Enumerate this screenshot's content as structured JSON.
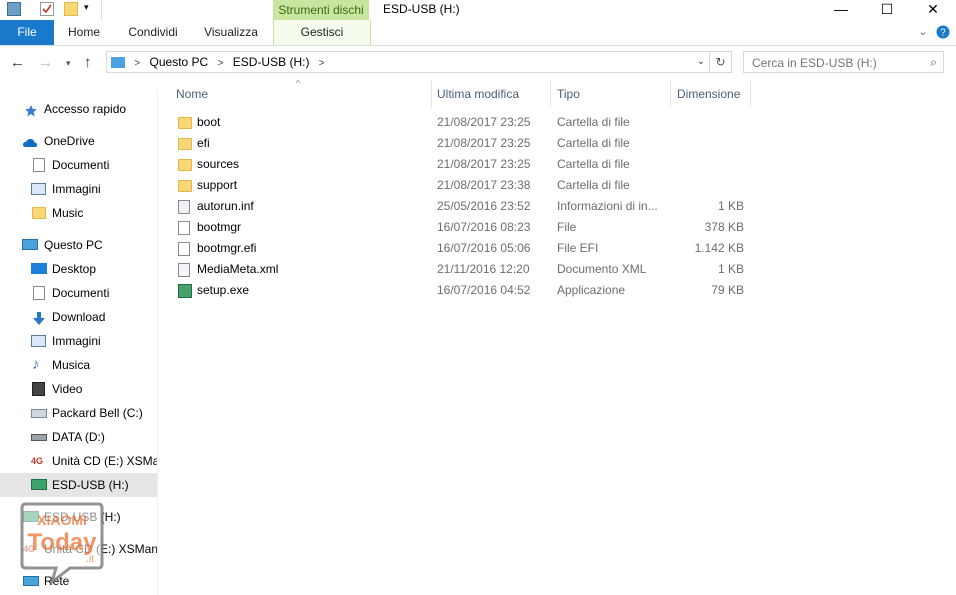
{
  "window": {
    "title": "ESD-USB (H:)",
    "context_tab_group": "Strumenti dischi",
    "minimize": "—",
    "maximize": "☐",
    "close": "✕"
  },
  "ribbon": {
    "tabs": [
      "File",
      "Home",
      "Condividi",
      "Visualizza",
      "Gestisci"
    ]
  },
  "address": {
    "crumbs": [
      "Questo PC",
      "ESD-USB (H:)"
    ],
    "search_placeholder": "Cerca in ESD-USB (H:)"
  },
  "columns": {
    "name": "Nome",
    "modified": "Ultima modifica",
    "type": "Tipo",
    "size": "Dimensione"
  },
  "files": [
    {
      "name": "boot",
      "date": "21/08/2017 23:25",
      "type": "Cartella di file",
      "size": "",
      "icon": "folder-icon"
    },
    {
      "name": "efi",
      "date": "21/08/2017 23:25",
      "type": "Cartella di file",
      "size": "",
      "icon": "folder-icon"
    },
    {
      "name": "sources",
      "date": "21/08/2017 23:25",
      "type": "Cartella di file",
      "size": "",
      "icon": "folder-icon"
    },
    {
      "name": "support",
      "date": "21/08/2017 23:38",
      "type": "Cartella di file",
      "size": "",
      "icon": "folder-icon"
    },
    {
      "name": "autorun.inf",
      "date": "25/05/2016 23:52",
      "type": "Informazioni di in...",
      "size": "1 KB",
      "icon": "settings-file-icon"
    },
    {
      "name": "bootmgr",
      "date": "16/07/2016 08:23",
      "type": "File",
      "size": "378 KB",
      "icon": "file-icon"
    },
    {
      "name": "bootmgr.efi",
      "date": "16/07/2016 05:06",
      "type": "File EFI",
      "size": "1.142 KB",
      "icon": "file-icon"
    },
    {
      "name": "MediaMeta.xml",
      "date": "21/11/2016 12:20",
      "type": "Documento XML",
      "size": "1 KB",
      "icon": "xml-file-icon"
    },
    {
      "name": "setup.exe",
      "date": "16/07/2016 04:52",
      "type": "Applicazione",
      "size": "79 KB",
      "icon": "setup-icon"
    }
  ],
  "nav": {
    "quick_access": "Accesso rapido",
    "onedrive": "OneDrive",
    "onedrive_children": [
      "Documenti",
      "Immagini",
      "Music"
    ],
    "this_pc": "Questo PC",
    "this_pc_children": [
      "Desktop",
      "Documenti",
      "Download",
      "Immagini",
      "Musica",
      "Video",
      "Packard Bell (C:)",
      "DATA (D:)",
      "Unità CD (E:) XSMar",
      "ESD-USB (H:)"
    ],
    "extra": [
      "ESD-USB (H:)",
      "Unità CD (E:) XSMana"
    ],
    "network": "Rete"
  },
  "watermark": {
    "line1": "XIAOMI",
    "line2": "Today",
    "line3": ".it"
  },
  "colors": {
    "file_tab": "#1979ca",
    "context_tab": "#c8e6a0",
    "selected": "#e5e5e5"
  }
}
